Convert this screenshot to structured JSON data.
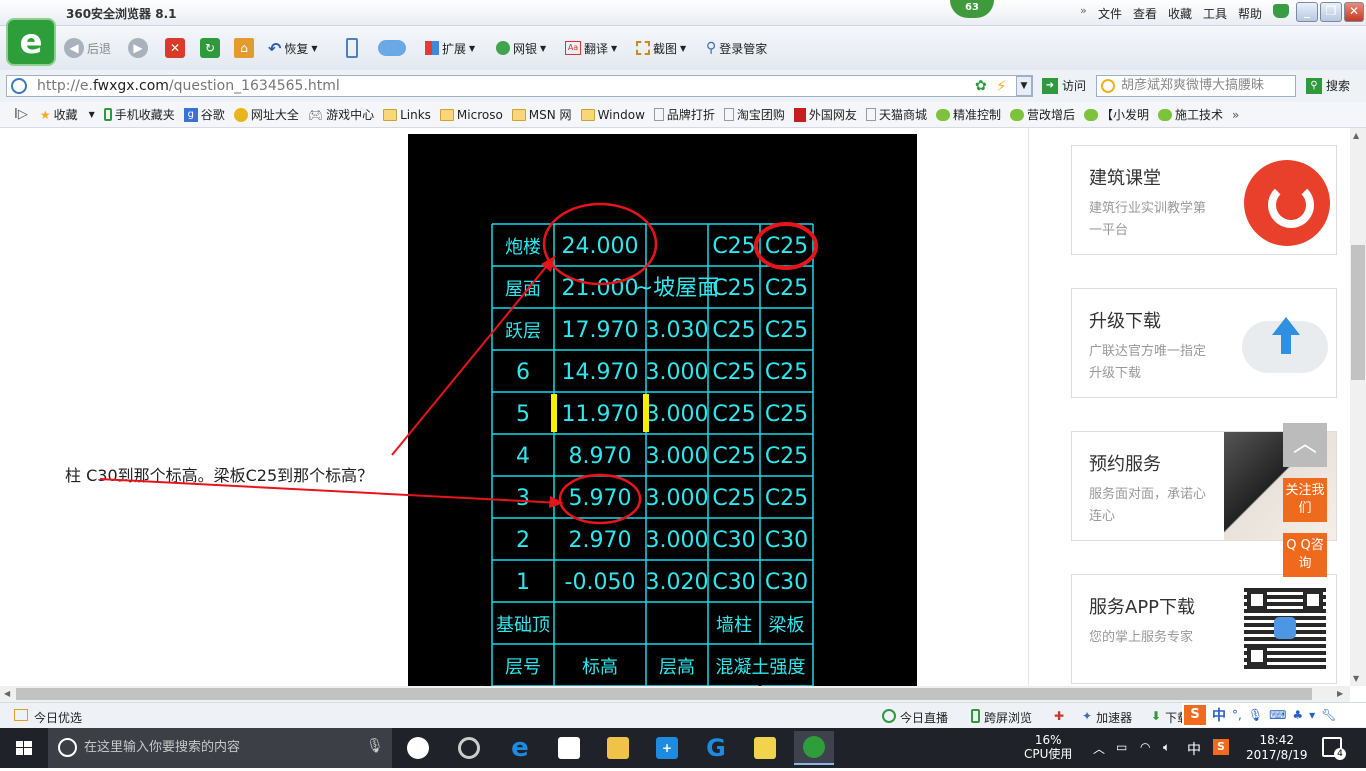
{
  "window": {
    "title": "360安全浏览器 8.1",
    "badge": "63",
    "menu": [
      "文件",
      "查看",
      "收藏",
      "工具",
      "帮助"
    ],
    "controls": {
      "min": "_",
      "max": "❐",
      "close": "✕"
    }
  },
  "toolbar": {
    "back": "后退",
    "restore": "恢复",
    "ext": "扩展",
    "bank": "网银",
    "translate": "翻译",
    "screenshot": "截图",
    "login": "登录管家"
  },
  "address": {
    "url_prefix": "http://e.",
    "url_domain": "fwxgx.com",
    "url_path": "/question_1634565.html",
    "go": "访问",
    "search_value": "胡彦斌郑爽微博大搞腰昧",
    "search_btn": "搜索"
  },
  "favorites": [
    "收藏",
    "手机收藏夹",
    "谷歌",
    "网址大全",
    "游戏中心",
    "Links",
    "Microso",
    "MSN 网",
    "Window",
    "品牌打折",
    "淘宝团购",
    "外国网友",
    "天猫商城",
    "精准控制",
    "营改增后",
    "【小发明",
    "施工技术"
  ],
  "question": "柱 C30到那个标高。梁板C25到那个标高？",
  "cad_table": {
    "header": [
      "层号",
      "标高",
      "层高",
      "混凝土强度"
    ],
    "rows": [
      [
        "炮楼",
        "24.000",
        "",
        "C25",
        "C25"
      ],
      [
        "屋面",
        "21.000",
        "~坡屋面",
        "C25",
        "C25"
      ],
      [
        "跃层",
        "17.970",
        "3.030",
        "C25",
        "C25"
      ],
      [
        "6",
        "14.970",
        "3.000",
        "C25",
        "C25"
      ],
      [
        "5",
        "11.970",
        "3.000",
        "C25",
        "C25"
      ],
      [
        "4",
        "8.970",
        "3.000",
        "C25",
        "C25"
      ],
      [
        "3",
        "5.970",
        "3.000",
        "C25",
        "C25"
      ],
      [
        "2",
        "2.970",
        "3.000",
        "C30",
        "C30"
      ],
      [
        "1",
        "-0.050",
        "3.020",
        "C30",
        "C30"
      ],
      [
        "基础顶",
        "",
        "",
        "墙柱",
        "梁板"
      ]
    ]
  },
  "sidebar": [
    {
      "title": "建筑课堂",
      "sub": "建筑行业实训教学第一平台"
    },
    {
      "title": "升级下载",
      "sub": "广联达官方唯一指定升级下载"
    },
    {
      "title": "预约服务",
      "sub": "服务面对面，承诺心连心"
    },
    {
      "title": "服务APP下载",
      "sub": "您的掌上服务专家"
    }
  ],
  "float_btns": {
    "back_top": "︿",
    "follow": "关注我们",
    "qq": "Q Q咨询"
  },
  "statusbar": {
    "left": "今日优选",
    "live": "今日直播",
    "cross": "跨屏浏览",
    "accel": "加速器",
    "download": "下载"
  },
  "taskbar": {
    "search_placeholder": "在这里输入你要搜索的内容",
    "cpu_pct": "16%",
    "cpu_label": "CPU使用",
    "ime": "中",
    "time": "18:42",
    "date": "2017/8/19",
    "notif": "4"
  },
  "colors": {
    "cad_line": "#17d9e8",
    "cad_text": "#2ee7ef",
    "annot": "#e8141b",
    "highlight": "#f7f000",
    "orange": "#f06a1e"
  }
}
